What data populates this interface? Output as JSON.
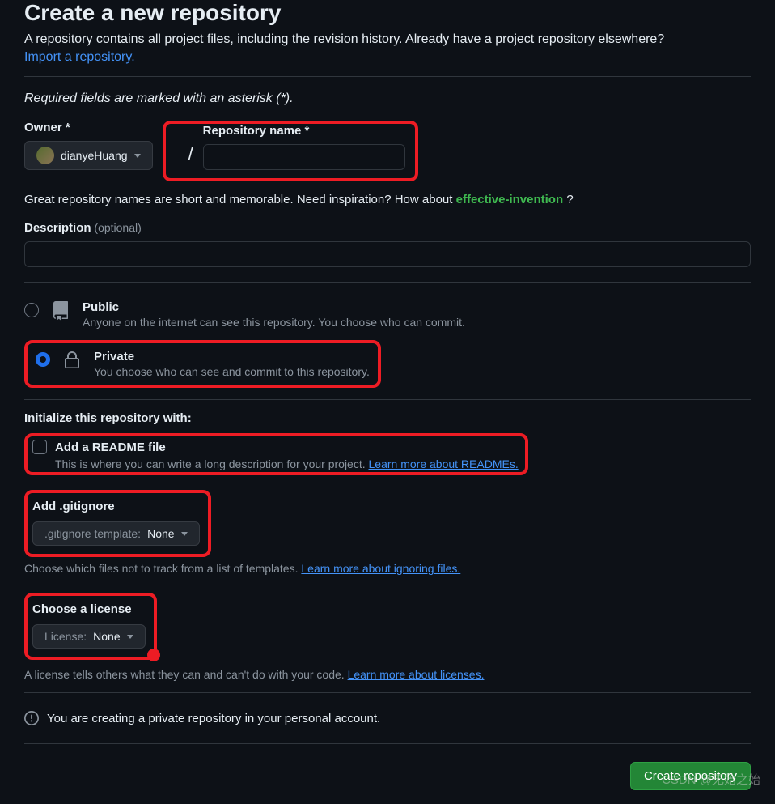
{
  "header": {
    "title": "Create a new repository",
    "subtitle": "A repository contains all project files, including the revision history. Already have a project repository elsewhere?",
    "import_link": "Import a repository.",
    "required_note": "Required fields are marked with an asterisk (*)."
  },
  "owner": {
    "label": "Owner *",
    "value": "dianyeHuang"
  },
  "repo_name": {
    "label": "Repository name *",
    "value": ""
  },
  "hint": {
    "text_prefix": "Great repository names are short and memorable. Need inspiration? How about ",
    "suggestion": "effective-invention",
    "text_suffix": " ?"
  },
  "description": {
    "label": "Description",
    "optional": "(optional)",
    "value": ""
  },
  "visibility": {
    "public": {
      "title": "Public",
      "desc": "Anyone on the internet can see this repository. You choose who can commit."
    },
    "private": {
      "title": "Private",
      "desc": "You choose who can see and commit to this repository."
    }
  },
  "init": {
    "heading": "Initialize this repository with:",
    "readme": {
      "label": "Add a README file",
      "desc": "This is where you can write a long description for your project. ",
      "link": "Learn more about READMEs."
    },
    "gitignore": {
      "heading": "Add .gitignore",
      "prefix": ".gitignore template: ",
      "value": "None",
      "desc": "Choose which files not to track from a list of templates. ",
      "link": "Learn more about ignoring files."
    },
    "license": {
      "heading": "Choose a license",
      "prefix": "License: ",
      "value": "None",
      "desc": "A license tells others what they can and can't do with your code. ",
      "link": "Learn more about licenses."
    }
  },
  "info": {
    "text": "You are creating a private repository in your personal account."
  },
  "submit": {
    "label": "Create repository"
  },
  "watermark": "CSDN @无始之始"
}
